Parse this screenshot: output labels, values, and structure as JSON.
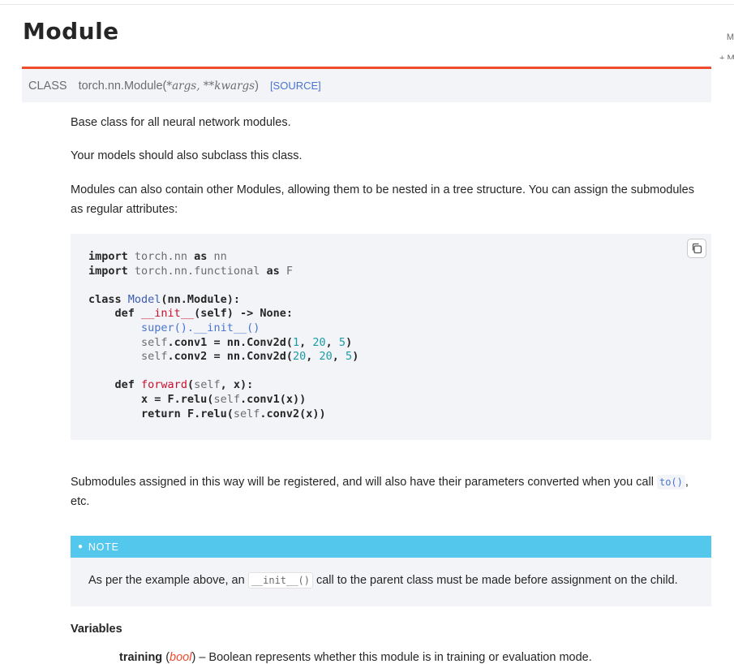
{
  "page": {
    "title": "Module",
    "right_edge": [
      "M",
      "+ M"
    ]
  },
  "signature": {
    "keyword": "CLASS",
    "name": "torch.nn.Module(",
    "params": "*args, **kwargs",
    "close": ")",
    "source_link": "[SOURCE]"
  },
  "description": {
    "p1": "Base class for all neural network modules.",
    "p2": "Your models should also subclass this class.",
    "p3": "Modules can also contain other Modules, allowing them to be nested in a tree structure. You can assign the submodules as regular attributes:",
    "p4_before": "Submodules assigned in this way will be registered, and will also have their parameters converted when you call ",
    "p4_code": "to()",
    "p4_after": ", etc."
  },
  "code": {
    "copy_icon": "copy-icon",
    "tokens": {
      "import": "import",
      "as": "as",
      "class": "class",
      "def": "def",
      "return": "return",
      "torch_nn": "torch.nn",
      "nn": "nn",
      "torch_nn_functional": "torch.nn.functional",
      "F": "F",
      "Model": "Model",
      "nn_Module": "(nn.Module):",
      "init": "__init__",
      "init_args": "(self) -> None:",
      "super": "super",
      "super_call": "().__init__()",
      "self": "self",
      "conv1_assign": ".conv1 = nn.Conv2d(",
      "conv2_assign": ".conv2 = nn.Conv2d(",
      "n1": "1",
      "n20": "20",
      "n5": "5",
      "comma": ", ",
      "close_paren": ")",
      "forward": "forward",
      "forward_args_open": "(",
      "forward_args_close": ", x):",
      "x_assign": "x = F.relu(",
      "conv1_x": ".conv1(x))",
      "return_expr": " F.relu(",
      "conv2_x": ".conv2(x))"
    }
  },
  "note": {
    "label": "NOTE",
    "text_before": "As per the example above, an ",
    "code": "__init__()",
    "text_after": " call to the parent class must be made before assignment on the child."
  },
  "variables": {
    "heading": "Variables",
    "training_name": "training",
    "training_type_open": " (",
    "training_type": "bool",
    "training_type_close": ")",
    "training_desc": " – Boolean represents whether this module is in training or evaluation mode."
  },
  "colors": {
    "accent_red": "#ee4c2c",
    "note_blue": "#54c7ec",
    "link_blue": "#4974d1",
    "code_bg": "#f3f4f7"
  }
}
